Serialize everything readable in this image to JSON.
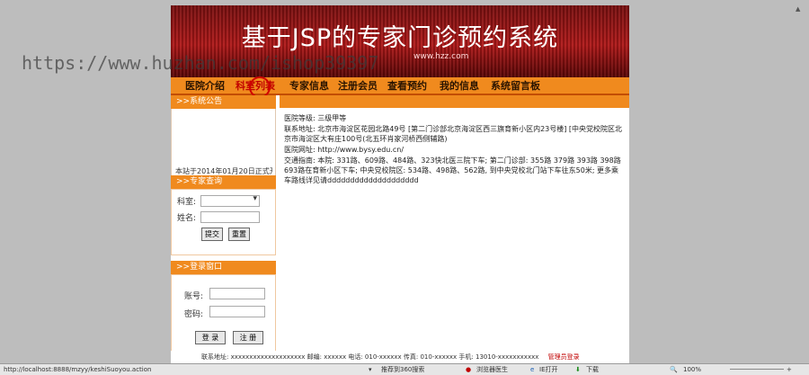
{
  "banner": {
    "title": "基于JSP的专家门诊预约系统",
    "subtitle": "www.hzz.com"
  },
  "menu": {
    "items": [
      "医院介绍",
      "科室列表",
      "专家信息",
      "注册会员",
      "查看预约",
      "我的信息",
      "系统留言板"
    ],
    "active_index": 1
  },
  "watermark": "https://www.huzhan.com/ishop39397",
  "sidebar": {
    "notice_title": ">>系统公告",
    "notice_text": "本站于2014年01月20日正式开",
    "search_title": ">>专家查询",
    "dept_label": "科室:",
    "name_label": "姓名:",
    "submit_label": "提交",
    "reset_label": "重置",
    "login_title": ">>登录窗口",
    "user_label": "账号:",
    "pass_label": "密码:",
    "login_label": "登 录",
    "register_label": "注 册"
  },
  "info": [
    "医院等级: 三级甲等",
    "联系地址: 北京市海淀区花园北路49号 [第二门诊部北京海淀区西三旗育新小区内23号楼] [中央党校院区北京市海淀区大有庄100号(北五环肖家河桥西侧辅路)",
    "医院网址: http://www.bysy.edu.cn/",
    "交通指南: 本院: 331路、609路、484路、323快北医三院下车; 第二门诊部: 355路 379路 393路 398路 693路在育新小区下车; 中央党校院区: 534路、498路、562路, 到中央党校北门站下车往东50米; 更多乘车路线详见请dddddddddddddddddddd"
  ],
  "footer": {
    "text": "联系地址: xxxxxxxxxxxxxxxxxxxx  邮编: xxxxxx 电话: 010-xxxxxx  传真: 010-xxxxxx  手机: 13010-xxxxxxxxxxx",
    "admin_link": "管理员登录"
  },
  "statusbar": {
    "url": "http://localhost:8888/mzyy/keshiSuoyou.action",
    "app1": "推荐到360搜索",
    "app2": "浏览器医生",
    "app3": "IE打开",
    "app4": "下载",
    "zoom": "100%"
  }
}
